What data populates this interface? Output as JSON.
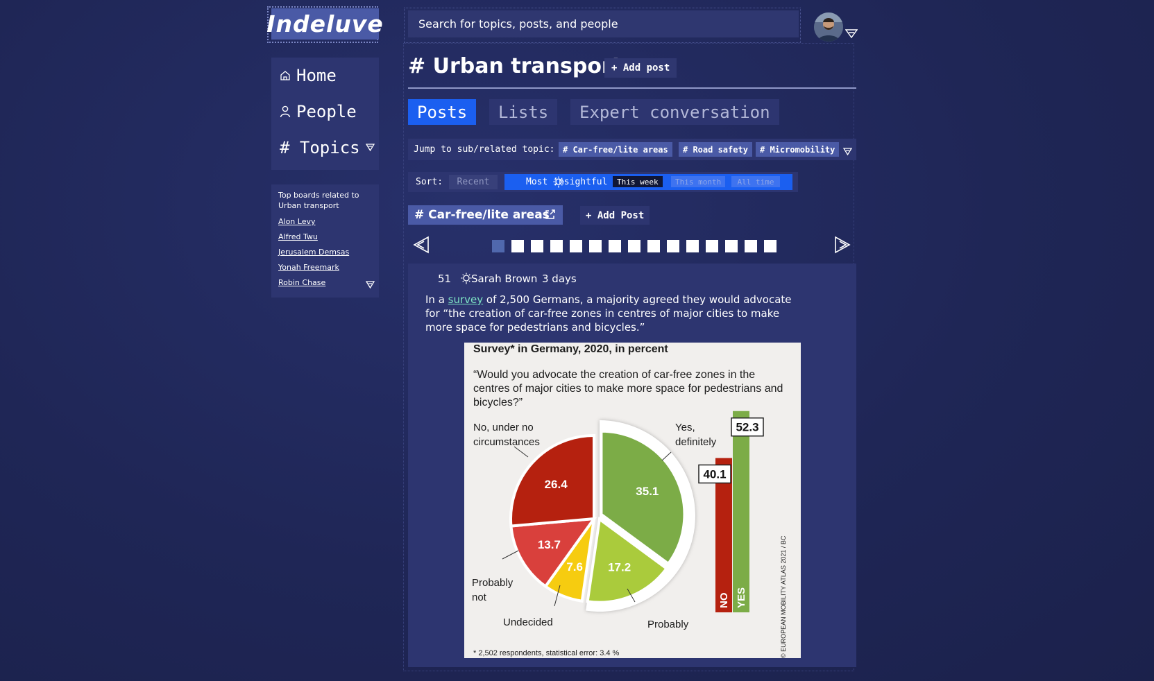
{
  "app": {
    "logo": "Indeluve"
  },
  "search": {
    "placeholder": "Search for topics, posts, and people"
  },
  "nav": {
    "home": "Home",
    "people": "People",
    "topics": "# Topics"
  },
  "boards": {
    "heading": "Top boards related to Urban transport",
    "items": [
      "Alon Levy",
      "Alfred Twu",
      "Jerusalem Demsas",
      "Yonah Freemark",
      "Robin Chase"
    ]
  },
  "topic": {
    "title": "# Urban transport",
    "add_post": "+ Add post"
  },
  "tabs": [
    "Posts",
    "Lists",
    "Expert conversation"
  ],
  "jump": {
    "label": "Jump to sub/related topic:",
    "chips": [
      "# Car-free/lite areas",
      "# Road safety",
      "# Micromobility"
    ]
  },
  "sort": {
    "label": "Sort:",
    "recent": "Recent",
    "insightful": "Most insightful",
    "periods": [
      "This week",
      "This month",
      "All time"
    ]
  },
  "board": {
    "name": "# Car-free/lite areas",
    "add_post": "+ Add Post"
  },
  "post": {
    "score": "51",
    "author": "Sarah Brown",
    "age": "3 days",
    "text_before": "In a ",
    "link": "survey",
    "text_after": " of 2,500 Germans, a majority agreed they would advocate for “the creation of car-free zones in centres of major cities to make more space for pedestrians and bicycles.”"
  },
  "figure": {
    "subtitle": "Survey* in Germany, 2020, in percent",
    "question": "“Would you advocate the creation of car-free zones in the centres of major cities to make more space for pedestrians and bicycles?”",
    "footnote": "* 2,502 respondents, statistical error: 3.4 %",
    "credit": "© EUROPEAN MOBILITY ATLAS 2021 / BC",
    "labels": {
      "no_under": "No, under no circumstances",
      "yes_def": "Yes, definitely",
      "prob_not": "Probably not",
      "undecided": "Undecided",
      "probably": "Probably"
    },
    "bar_no_label": "NO",
    "bar_yes_label": "YES"
  },
  "chart_data": {
    "type": "pie",
    "title": "Survey* in Germany, 2020, in percent",
    "slices": [
      {
        "name": "Yes, definitely",
        "value": 35.1,
        "color": "#7cac47"
      },
      {
        "name": "Probably",
        "value": 17.2,
        "color": "#aacb3c"
      },
      {
        "name": "Undecided",
        "value": 7.6,
        "color": "#f6cc10"
      },
      {
        "name": "Probably not",
        "value": 13.7,
        "color": "#d9403c"
      },
      {
        "name": "No, under no circumstances",
        "value": 26.4,
        "color": "#b5210f"
      }
    ],
    "totals": [
      {
        "name": "NO",
        "value": 40.1,
        "color": "#b5210f"
      },
      {
        "name": "YES",
        "value": 52.3,
        "color": "#7cac47"
      }
    ]
  },
  "colors": {
    "accent": "#1b5ff0",
    "panel": "#2d3570",
    "chip": "#4a5aa6",
    "link": "#7de3c4"
  }
}
